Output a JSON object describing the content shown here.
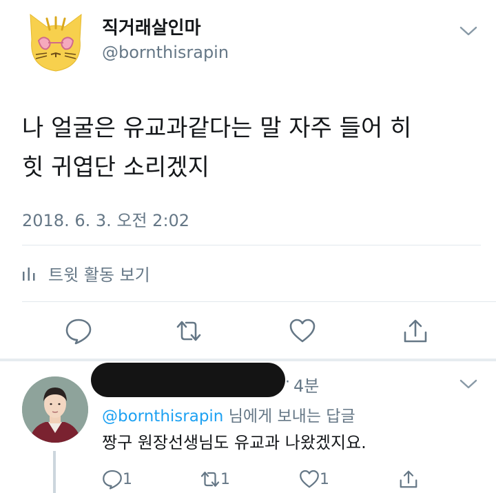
{
  "tweet": {
    "display_name": "직거래살인마",
    "handle": "@bornthisrapin",
    "text_lines": [
      "나 얼굴은 유교과같다는 말 자주 들어 히",
      "힛 귀엽단 소리겠지"
    ],
    "timestamp": "2018. 6. 3. 오전 2:02",
    "activity_label": "트윗 활동 보기",
    "icons": [
      "reply-icon",
      "retweet-icon",
      "like-icon",
      "share-icon"
    ]
  },
  "reply": {
    "time": "4분",
    "separator": "·",
    "replying_to_handle": "@bornthisrapin",
    "replying_to_suffix": " 님에게 보내는 답글",
    "text": "짱구 원장선생님도 유교과 나왔겠지요.",
    "reply_count": "1",
    "retweet_count": "1",
    "like_count": "1"
  },
  "colors": {
    "text": "#14171a",
    "secondary": "#657786",
    "link": "#1da1f2",
    "divider": "#e1e8ed"
  }
}
